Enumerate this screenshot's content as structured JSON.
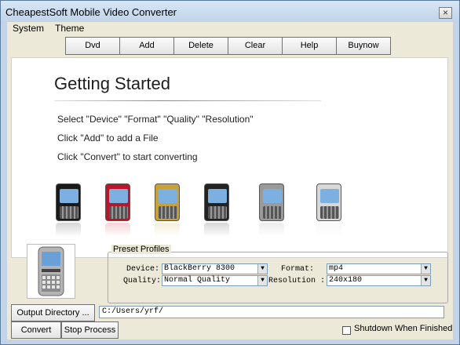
{
  "window": {
    "title": "CheapestSoft Mobile Video Converter",
    "close_glyph": "×"
  },
  "menu": {
    "items": [
      "System",
      "Theme"
    ]
  },
  "toolbar": {
    "buttons": [
      "Dvd",
      "Add",
      "Delete",
      "Clear",
      "Help",
      "Buynow"
    ]
  },
  "getting_started": {
    "title": "Getting Started",
    "lines": [
      "Select \"Device\" \"Format\" \"Quality\" \"Resolution\"",
      "Click  \"Add\" to add a File",
      "Click  \"Convert\" to start converting"
    ]
  },
  "phones": [
    {
      "name": "iphone",
      "color": "#1a1a1a"
    },
    {
      "name": "red-flip-phone",
      "color": "#b8162a"
    },
    {
      "name": "gold-phone",
      "color": "#c9a13a"
    },
    {
      "name": "blackberry-bold",
      "color": "#222222"
    },
    {
      "name": "blackberry-curve-silver",
      "color": "#9a9a9a"
    },
    {
      "name": "blackberry-curve-white",
      "color": "#d8d8d8"
    }
  ],
  "preset": {
    "legend": "Preset Profiles",
    "device_label": "Device:",
    "device_value": "BlackBerry 8300",
    "format_label": "Format:",
    "format_value": "mp4",
    "quality_label": "Quality:",
    "quality_value": "Normal Quality",
    "resolution_label": "Resolution :",
    "resolution_value": "240x180"
  },
  "output": {
    "button": "Output Directory ...",
    "path": "C:/Users/yrf/"
  },
  "actions": {
    "convert": "Convert",
    "stop": "Stop Process"
  },
  "shutdown": {
    "label": "Shutdown When Finished",
    "checked": false
  }
}
